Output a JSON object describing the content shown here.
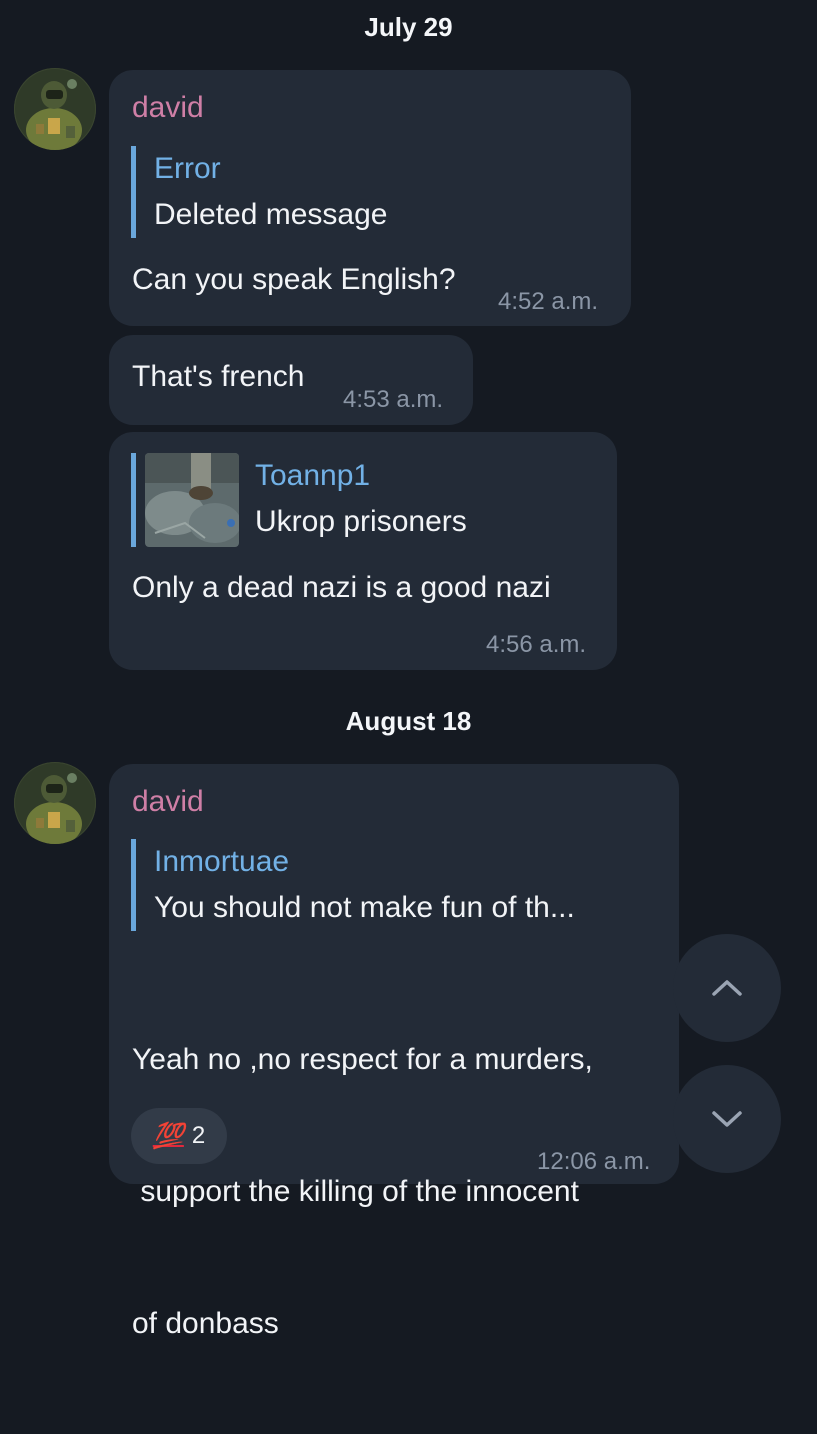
{
  "dates": {
    "first": "July 29",
    "second": "August 18"
  },
  "messages": [
    {
      "sender": "david",
      "reply_name": "Error",
      "reply_text": "Deleted message",
      "text": "Can you speak English?",
      "time": "4:52 a.m."
    },
    {
      "text": "That's french",
      "time": "4:53 a.m."
    },
    {
      "reply_name": "Toannp1",
      "reply_text": "Ukrop prisoners",
      "text": "Only a dead nazi is a good nazi",
      "time": "4:56 a.m."
    },
    {
      "sender": "david",
      "reply_name": "Inmortuae",
      "reply_text": "You should not make fun of th...",
      "text_lines": [
        "Yeah no ,no respect for a murders,",
        " support the killing of the innocent",
        "of donbass"
      ],
      "time": "12:06 a.m.",
      "reaction": {
        "emoji": "💯",
        "count": "2"
      }
    }
  ],
  "icons": {
    "avatar": "soldier-avatar",
    "scroll_up": "chevron-up-icon",
    "scroll_down": "chevron-down-icon"
  },
  "colors": {
    "background": "#151a22",
    "bubble": "#232b37",
    "sender": "#cf7fa6",
    "reply_accent": "#6aa7db",
    "timestamp": "#8b96a6"
  }
}
